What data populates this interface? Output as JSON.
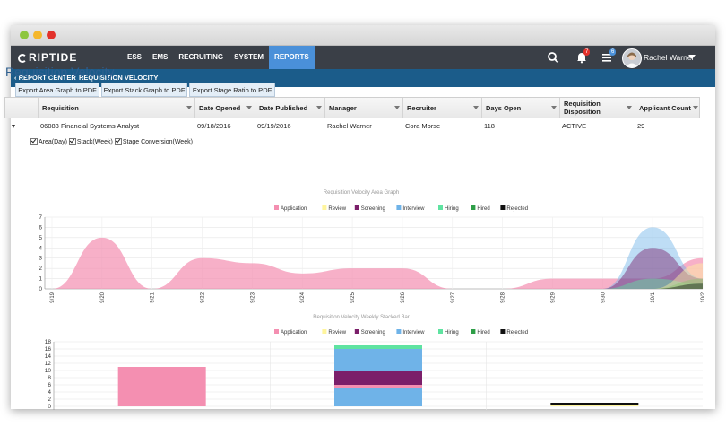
{
  "app": {
    "logo_text": "RIPTIDE",
    "nav": [
      {
        "label": "ESS",
        "active": false
      },
      {
        "label": "EMS",
        "active": false
      },
      {
        "label": "RECRUITING",
        "active": false
      },
      {
        "label": "SYSTEM",
        "active": false
      },
      {
        "label": "REPORTS",
        "active": true
      }
    ],
    "notifications_count": "7",
    "tasks_count": "6",
    "user_name": "Rachel Warner"
  },
  "subnav": {
    "back_label": "REPORT CENTER",
    "current": "REQUISITION VELOCITY"
  },
  "page": {
    "title": "Requisition Velocity",
    "buttons": [
      "Export Area Graph to PDF",
      "Export Stack Graph to PDF",
      "Export Stage Ratio to PDF"
    ]
  },
  "table": {
    "headers": [
      "Requisition",
      "Date Opened",
      "Date Published",
      "Manager",
      "Recruiter",
      "Days Open",
      "Requisition Disposition",
      "Applicant Count"
    ],
    "rows": [
      [
        "06083 Financial Systems Analyst",
        "09/18/2016",
        "09/19/2016",
        "Rachel Warner",
        "Cora Morse",
        "118",
        "ACTIVE",
        "29"
      ]
    ]
  },
  "options": [
    "Area(Day)",
    "Stack(Week)",
    "Stage Conversion(Week)"
  ],
  "colors": {
    "Application": "#f48fb1",
    "Review": "#fff59d",
    "Screening": "#7b1f6a",
    "Interview": "#6fb3e8",
    "Hiring": "#5fe3a1",
    "Hired": "#2e9e47",
    "Rejected": "#111111"
  },
  "chart_data": [
    {
      "type": "area",
      "title": "Requisition Velocity Area Graph",
      "legend": [
        "Application",
        "Review",
        "Screening",
        "Interview",
        "Hiring",
        "Hired",
        "Rejected"
      ],
      "legend_placement": "top",
      "x": [
        "9/19",
        "9/20",
        "9/21",
        "9/22",
        "9/23",
        "9/24",
        "9/25",
        "9/26",
        "9/27",
        "9/28",
        "9/29",
        "9/30",
        "10/1",
        "10/2"
      ],
      "ylim": [
        0,
        7
      ],
      "yticks": [
        0,
        1,
        2,
        3,
        4,
        5,
        6,
        7
      ],
      "grid": true,
      "series": [
        {
          "name": "Application",
          "values": [
            0,
            5,
            0,
            3,
            2.5,
            1.5,
            2,
            2,
            0,
            0,
            1,
            1,
            1,
            3
          ]
        },
        {
          "name": "Review",
          "values": [
            0,
            0,
            0,
            0,
            0,
            0,
            0,
            0,
            0,
            0,
            0,
            0,
            0,
            2.5
          ]
        },
        {
          "name": "Screening",
          "values": [
            0,
            0,
            0,
            0,
            0,
            0,
            0,
            0,
            0,
            0,
            0,
            0,
            4,
            1
          ]
        },
        {
          "name": "Interview",
          "values": [
            0,
            0,
            0,
            0,
            0,
            0,
            0,
            0,
            0,
            0,
            0,
            0,
            6,
            1
          ]
        },
        {
          "name": "Hiring",
          "values": [
            0,
            0,
            0,
            0,
            0,
            0,
            0,
            0,
            0,
            0,
            0,
            0,
            1,
            0.5
          ]
        },
        {
          "name": "Hired",
          "values": [
            0,
            0,
            0,
            0,
            0,
            0,
            0,
            0,
            0,
            0,
            0,
            0,
            0,
            1
          ]
        },
        {
          "name": "Rejected",
          "values": [
            0,
            0,
            0,
            0,
            0,
            0,
            0,
            0,
            0,
            0,
            0,
            0,
            0,
            0.5
          ]
        }
      ]
    },
    {
      "type": "bar",
      "stacked": true,
      "title": "Requisition Velocity Weekly Stacked Bar",
      "legend": [
        "Application",
        "Review",
        "Screening",
        "Interview",
        "Hiring",
        "Hired",
        "Rejected"
      ],
      "legend_placement": "top",
      "ylim": [
        0,
        18
      ],
      "yticks": [
        0,
        2,
        4,
        6,
        8,
        10,
        12,
        14,
        16,
        18
      ],
      "grid": true,
      "bars": [
        {
          "segments": [
            {
              "series": "Application",
              "value": 11
            }
          ]
        },
        {
          "segments": [
            {
              "series": "Interview",
              "value": 5
            },
            {
              "series": "Application",
              "value": 1
            },
            {
              "series": "Screening",
              "value": 4
            },
            {
              "series": "Interview",
              "value": 6
            },
            {
              "series": "Hiring",
              "value": 1
            }
          ]
        },
        {
          "segments": [
            {
              "series": "Review",
              "value": 0.5
            },
            {
              "series": "Rejected",
              "value": 0.5
            }
          ]
        }
      ]
    }
  ]
}
